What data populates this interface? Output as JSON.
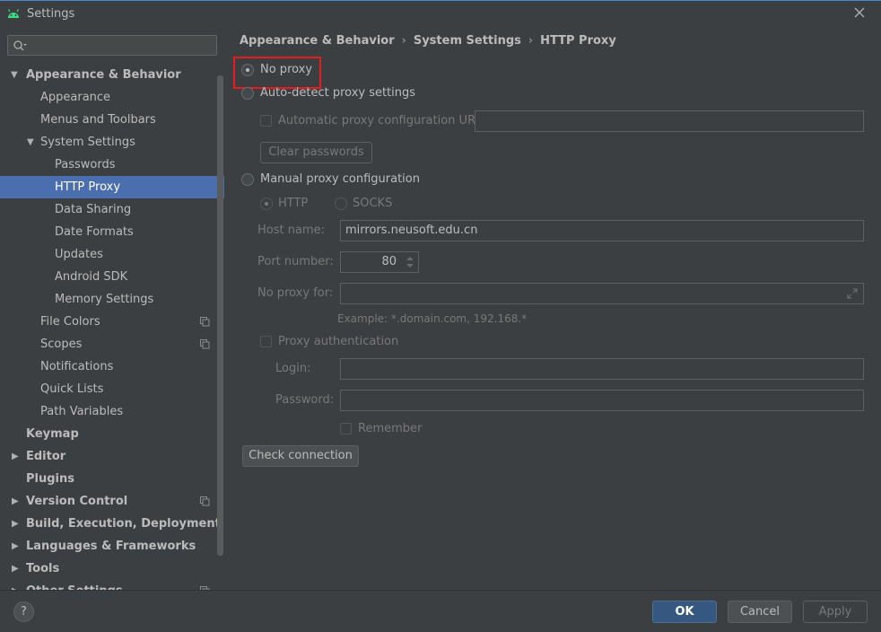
{
  "window": {
    "title": "Settings",
    "accent": "#4b6eaf"
  },
  "search": {
    "placeholder": "",
    "icon": "search-icon"
  },
  "tree": [
    {
      "label": "Appearance & Behavior",
      "expanded": true
    },
    {
      "label": "Appearance"
    },
    {
      "label": "Menus and Toolbars"
    },
    {
      "label": "System Settings",
      "expanded": true
    },
    {
      "label": "Passwords"
    },
    {
      "label": "HTTP Proxy",
      "selected": true
    },
    {
      "label": "Data Sharing"
    },
    {
      "label": "Date Formats"
    },
    {
      "label": "Updates"
    },
    {
      "label": "Android SDK"
    },
    {
      "label": "Memory Settings"
    },
    {
      "label": "File Colors"
    },
    {
      "label": "Scopes"
    },
    {
      "label": "Notifications"
    },
    {
      "label": "Quick Lists"
    },
    {
      "label": "Path Variables"
    },
    {
      "label": "Keymap"
    },
    {
      "label": "Editor"
    },
    {
      "label": "Plugins"
    },
    {
      "label": "Version Control"
    },
    {
      "label": "Build, Execution, Deployment"
    },
    {
      "label": "Languages & Frameworks"
    },
    {
      "label": "Tools"
    },
    {
      "label": "Other Settings"
    }
  ],
  "breadcrumb": [
    "Appearance & Behavior",
    "System Settings",
    "HTTP Proxy"
  ],
  "proxy": {
    "no_proxy": "No proxy",
    "auto_detect": "Auto-detect proxy settings",
    "auto_config_url": "Automatic proxy configuration URL:",
    "auto_config_url_value": "",
    "clear_passwords": "Clear passwords",
    "manual": "Manual proxy configuration",
    "http": "HTTP",
    "socks": "SOCKS",
    "host_label": "Host name:",
    "host_value": "mirrors.neusoft.edu.cn",
    "port_label": "Port number:",
    "port_value": "80",
    "no_proxy_for_label": "No proxy for:",
    "no_proxy_for_value": "",
    "example": "Example: *.domain.com, 192.168.*",
    "proxy_auth": "Proxy authentication",
    "login_label": "Login:",
    "password_label": "Password:",
    "remember": "Remember",
    "check_connection": "Check connection",
    "selected_mode": "No proxy"
  },
  "footer": {
    "help": "?",
    "ok": "OK",
    "cancel": "Cancel",
    "apply": "Apply"
  }
}
